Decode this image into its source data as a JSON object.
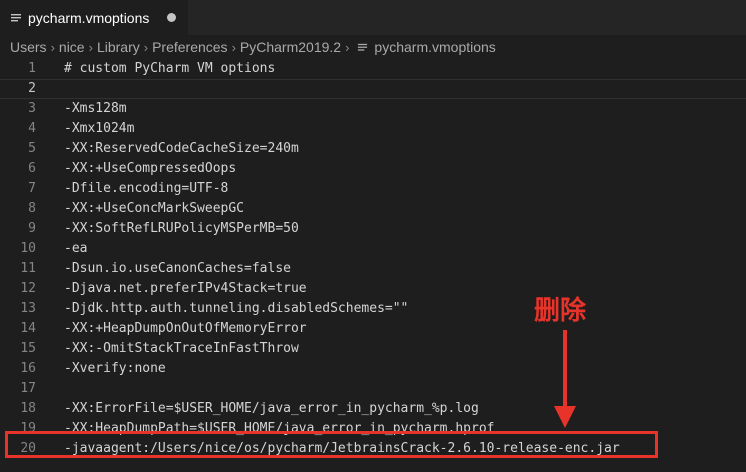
{
  "tab": {
    "title": "pycharm.vmoptions",
    "icon": "file-lines-icon"
  },
  "breadcrumb": [
    "Users",
    "nice",
    "Library",
    "Preferences",
    "PyCharm2019.2",
    "pycharm.vmoptions"
  ],
  "lines": [
    {
      "n": "1",
      "text": "# custom PyCharm VM options"
    },
    {
      "n": "2",
      "text": ""
    },
    {
      "n": "3",
      "text": "-Xms128m"
    },
    {
      "n": "4",
      "text": "-Xmx1024m"
    },
    {
      "n": "5",
      "text": "-XX:ReservedCodeCacheSize=240m"
    },
    {
      "n": "6",
      "text": "-XX:+UseCompressedOops"
    },
    {
      "n": "7",
      "text": "-Dfile.encoding=UTF-8"
    },
    {
      "n": "8",
      "text": "-XX:+UseConcMarkSweepGC"
    },
    {
      "n": "9",
      "text": "-XX:SoftRefLRUPolicyMSPerMB=50"
    },
    {
      "n": "10",
      "text": "-ea"
    },
    {
      "n": "11",
      "text": "-Dsun.io.useCanonCaches=false"
    },
    {
      "n": "12",
      "text": "-Djava.net.preferIPv4Stack=true"
    },
    {
      "n": "13",
      "text": "-Djdk.http.auth.tunneling.disabledSchemes=\"\""
    },
    {
      "n": "14",
      "text": "-XX:+HeapDumpOnOutOfMemoryError"
    },
    {
      "n": "15",
      "text": "-XX:-OmitStackTraceInFastThrow"
    },
    {
      "n": "16",
      "text": "-Xverify:none"
    },
    {
      "n": "17",
      "text": ""
    },
    {
      "n": "18",
      "text": "-XX:ErrorFile=$USER_HOME/java_error_in_pycharm_%p.log"
    },
    {
      "n": "19",
      "text": "-XX:HeapDumpPath=$USER_HOME/java_error_in_pycharm.hprof"
    },
    {
      "n": "20",
      "text": "-javaagent:/Users/nice/os/pycharm/JetbrainsCrack-2.6.10-release-enc.jar"
    }
  ],
  "annotation": {
    "label": "删除",
    "color": "#e8332a"
  }
}
